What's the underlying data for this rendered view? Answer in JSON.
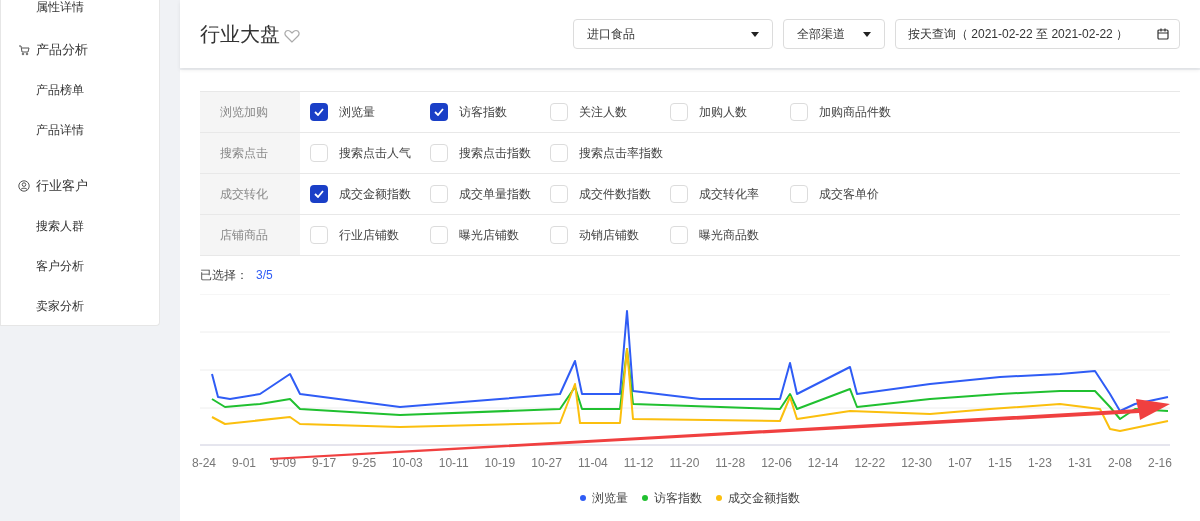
{
  "sidebar": {
    "leading_items": [
      "属性详情"
    ],
    "groups": [
      {
        "label": "产品分析",
        "items": [
          "产品榜单",
          "产品详情"
        ]
      },
      {
        "label": "行业客户",
        "items": [
          "搜索人群",
          "客户分析",
          "卖家分析"
        ]
      }
    ]
  },
  "header": {
    "title": "行业大盘",
    "category_select": "进口食品",
    "channel_select": "全部渠道",
    "date_query": "按天查询（ 2021-02-22 至 2021-02-22 ）"
  },
  "filters": [
    {
      "label": "浏览加购",
      "options": [
        {
          "label": "浏览量",
          "checked": true
        },
        {
          "label": "访客指数",
          "checked": true
        },
        {
          "label": "关注人数",
          "checked": false
        },
        {
          "label": "加购人数",
          "checked": false
        },
        {
          "label": "加购商品件数",
          "checked": false
        }
      ]
    },
    {
      "label": "搜索点击",
      "options": [
        {
          "label": "搜索点击人气",
          "checked": false
        },
        {
          "label": "搜索点击指数",
          "checked": false
        },
        {
          "label": "搜索点击率指数",
          "checked": false
        }
      ]
    },
    {
      "label": "成交转化",
      "options": [
        {
          "label": "成交金额指数",
          "checked": true
        },
        {
          "label": "成交单量指数",
          "checked": false
        },
        {
          "label": "成交件数指数",
          "checked": false
        },
        {
          "label": "成交转化率",
          "checked": false
        },
        {
          "label": "成交客单价",
          "checked": false
        }
      ]
    },
    {
      "label": "店铺商品",
      "options": [
        {
          "label": "行业店铺数",
          "checked": false
        },
        {
          "label": "曝光店铺数",
          "checked": false
        },
        {
          "label": "动销店铺数",
          "checked": false
        },
        {
          "label": "曝光商品数",
          "checked": false
        }
      ]
    }
  ],
  "selection": {
    "label": "已选择：",
    "value": "3/5"
  },
  "chart": {
    "x_labels": [
      "8-24",
      "9-01",
      "9-09",
      "9-17",
      "9-25",
      "10-03",
      "10-11",
      "10-19",
      "10-27",
      "11-04",
      "11-12",
      "11-20",
      "11-28",
      "12-06",
      "12-14",
      "12-22",
      "12-30",
      "1-07",
      "1-15",
      "1-23",
      "1-31",
      "2-08",
      "2-16"
    ],
    "legend": [
      {
        "label": "浏览量",
        "color": "#2f5cf5"
      },
      {
        "label": "访客指数",
        "color": "#20c030"
      },
      {
        "label": "成交金额指数",
        "color": "#fbbf0e"
      }
    ]
  }
}
